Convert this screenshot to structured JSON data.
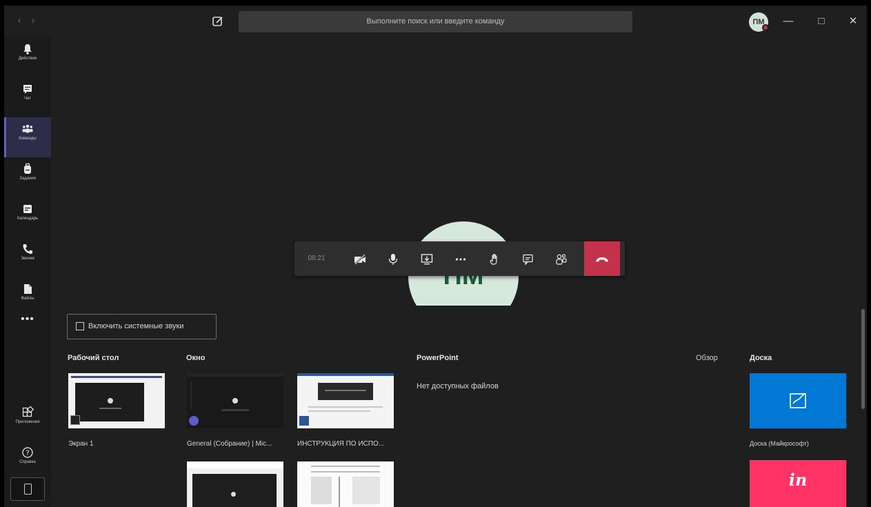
{
  "titlebar": {
    "back": "‹",
    "forward": "›",
    "search_placeholder": "Выполните поиск или введите команду",
    "avatar_initials": "ПМ",
    "minimize": "—",
    "maximize": "□",
    "close": "✕"
  },
  "appbar": {
    "items": [
      {
        "label": "Действия"
      },
      {
        "label": "Чат"
      },
      {
        "label": "Команды"
      },
      {
        "label": "Задания"
      },
      {
        "label": "Календарь"
      },
      {
        "label": "Звонки"
      },
      {
        "label": "Файлы"
      }
    ],
    "more": "•••",
    "apps_label": "Приложения",
    "help_label": "Справка"
  },
  "stage": {
    "avatar_initials": "ПМ"
  },
  "call_bar": {
    "timer": "08:21",
    "hangup_color": "#c4314b"
  },
  "tray": {
    "system_sounds": "Включить системные звуки",
    "desktop_title": "Рабочий стол",
    "window_title": "Окно",
    "powerpoint_title": "PowerPoint",
    "browse": "Обзор",
    "whiteboard_title": "Доска",
    "no_files": "Нет доступных файлов",
    "desktop_items": [
      {
        "label": "Экран 1"
      }
    ],
    "window_items": [
      {
        "label": "General (Собрание) | Mic..."
      },
      {
        "label": "ИНСТРУКЦИЯ ПО ИСПО..."
      }
    ],
    "whiteboards": [
      {
        "label": "Доска (Майкрософт)",
        "color": "#0078d4"
      },
      {
        "label": "in",
        "color": "#ff3366"
      }
    ]
  },
  "colors": {
    "accent": "#6264a7",
    "background": "#1f1f1f"
  }
}
